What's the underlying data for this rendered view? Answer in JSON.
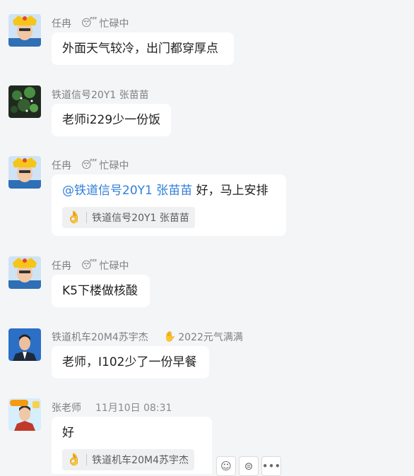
{
  "messages": [
    {
      "sender": "任冉",
      "status": "忙碌中",
      "text": "外面天气较冷，出门都穿厚点"
    },
    {
      "sender": "铁道信号20Y1 张苗苗",
      "text": "老师i229少一份饭"
    },
    {
      "sender": "任冉",
      "status": "忙碌中",
      "mention": "@铁道信号20Y1  张苗苗",
      "text": " 好，马上安排",
      "reply_reaction_user": "铁道信号20Y1  张苗苗"
    },
    {
      "sender": "任冉",
      "status": "忙碌中",
      "text": "K5下楼做核酸"
    },
    {
      "sender": "铁道机车20M4苏宇杰",
      "status": "2022元气满满",
      "text": "老师，I102少了一份早餐"
    },
    {
      "sender": "张老师",
      "time": "11月10日 08:31",
      "text": "好",
      "reply_reaction_user": "铁道机车20M4苏宇杰"
    }
  ],
  "icons": {
    "busy_status": "sleeping-face-icon",
    "reaction": "ok-hand-icon",
    "yuanqi_status": "raised-hand-icon",
    "action_emoji": "emoji-icon",
    "action_reply": "reply-icon",
    "action_more": "more-icon"
  },
  "colors": {
    "mention": "#2f7fd8",
    "background": "#f4f5f7",
    "bubble": "#ffffff"
  }
}
